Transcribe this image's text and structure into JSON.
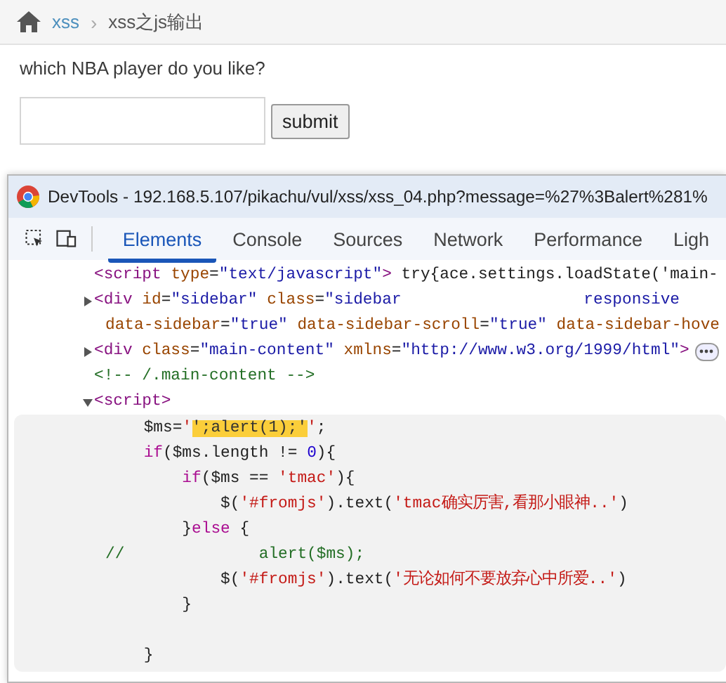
{
  "breadcrumb": {
    "home_link": "xss",
    "separator": "›",
    "current": "xss之js输出"
  },
  "question": "which NBA player do you like?",
  "submit": "submit",
  "devtools": {
    "title": "DevTools - 192.168.5.107/pikachu/vul/xss/xss_04.php?message=%27%3Balert%281%",
    "tabs": [
      {
        "label": "Elements",
        "selected": true
      },
      {
        "label": "Console",
        "selected": false
      },
      {
        "label": "Sources",
        "selected": false
      },
      {
        "label": "Network",
        "selected": false
      },
      {
        "label": "Performance",
        "selected": false
      },
      {
        "label": "Ligh",
        "selected": false
      }
    ],
    "dom": [
      {
        "kind": "partial",
        "lines": [
          [
            {
              "kind": "tag",
              "text": "<script"
            },
            {
              "kind": "attr",
              "text": " type"
            },
            {
              "kind": "plain",
              "text": "="
            },
            {
              "kind": "value",
              "text": "\"text/javascript\""
            },
            {
              "kind": "tag",
              "text": ">"
            },
            {
              "kind": "plain",
              "text": " try{ace.settings.loadState('main-"
            }
          ]
        ]
      },
      {
        "kind": "element",
        "expanded": false,
        "ellipsis": false,
        "lines": [
          [
            {
              "kind": "tag",
              "text": "<div"
            },
            {
              "kind": "attr",
              "text": " id"
            },
            {
              "kind": "plain",
              "text": "="
            },
            {
              "kind": "value",
              "text": "\"sidebar\""
            },
            {
              "kind": "attr",
              "text": " class"
            },
            {
              "kind": "plain",
              "text": "="
            },
            {
              "kind": "value",
              "text": "\"sidebar                   responsive"
            }
          ],
          [
            {
              "kind": "attr",
              "text": "data-sidebar"
            },
            {
              "kind": "plain",
              "text": "="
            },
            {
              "kind": "value",
              "text": "\"true\""
            },
            {
              "kind": "attr",
              "text": " data-sidebar-scroll"
            },
            {
              "kind": "plain",
              "text": "="
            },
            {
              "kind": "value",
              "text": "\"true\""
            },
            {
              "kind": "attr",
              "text": " data-sidebar-hove"
            }
          ]
        ]
      },
      {
        "kind": "element",
        "expanded": false,
        "ellipsis": true,
        "lines": [
          [
            {
              "kind": "tag",
              "text": "<div"
            },
            {
              "kind": "attr",
              "text": " class"
            },
            {
              "kind": "plain",
              "text": "="
            },
            {
              "kind": "value",
              "text": "\"main-content\""
            },
            {
              "kind": "attr",
              "text": " xmlns"
            },
            {
              "kind": "plain",
              "text": "="
            },
            {
              "kind": "value",
              "text": "\"http://www.w3.org/1999/html\""
            },
            {
              "kind": "tag",
              "text": ">"
            }
          ]
        ]
      },
      {
        "kind": "comment",
        "lines": [
          [
            {
              "kind": "comment",
              "text": "<!-- /.main-content -->"
            }
          ]
        ]
      },
      {
        "kind": "element",
        "expanded": true,
        "ellipsis": false,
        "lines": [
          [
            {
              "kind": "tag",
              "text": "<script>"
            }
          ]
        ],
        "code": [
          {
            "kind": "code",
            "tokens": [
              {
                "kind": "plain",
                "text": "    $ms="
              },
              {
                "kind": "string",
                "text": "'"
              },
              {
                "kind": "highlight",
                "text": "';alert(1);'"
              },
              {
                "kind": "string",
                "text": "'"
              },
              {
                "kind": "plain",
                "text": ";"
              }
            ]
          },
          {
            "kind": "code",
            "tokens": [
              {
                "kind": "keyword",
                "text": "    if"
              },
              {
                "kind": "plain",
                "text": "($ms.length != "
              },
              {
                "kind": "number",
                "text": "0"
              },
              {
                "kind": "plain",
                "text": "){"
              }
            ]
          },
          {
            "kind": "code",
            "tokens": [
              {
                "kind": "keyword",
                "text": "        if"
              },
              {
                "kind": "plain",
                "text": "($ms == "
              },
              {
                "kind": "string",
                "text": "'tmac'"
              },
              {
                "kind": "plain",
                "text": "){"
              }
            ]
          },
          {
            "kind": "code",
            "tokens": [
              {
                "kind": "plain",
                "text": "            $("
              },
              {
                "kind": "string",
                "text": "'#fromjs'"
              },
              {
                "kind": "plain",
                "text": ").text("
              },
              {
                "kind": "string",
                "text": "'tmac确实厉害,看那小眼神..'"
              },
              {
                "kind": "plain",
                "text": ")"
              }
            ]
          },
          {
            "kind": "code",
            "tokens": [
              {
                "kind": "plain",
                "text": "        }"
              },
              {
                "kind": "keyword",
                "text": "else"
              },
              {
                "kind": "plain",
                "text": " {"
              }
            ]
          },
          {
            "kind": "code",
            "tokens": [
              {
                "kind": "jscomment",
                "text": "//              alert($ms);"
              }
            ]
          },
          {
            "kind": "code",
            "tokens": [
              {
                "kind": "plain",
                "text": "            $("
              },
              {
                "kind": "string",
                "text": "'#fromjs'"
              },
              {
                "kind": "plain",
                "text": ").text("
              },
              {
                "kind": "string",
                "text": "'无论如何不要放弃心中所爱..'"
              },
              {
                "kind": "plain",
                "text": ")"
              }
            ]
          },
          {
            "kind": "code",
            "tokens": [
              {
                "kind": "plain",
                "text": "        }"
              }
            ]
          },
          {
            "kind": "blank"
          },
          {
            "kind": "code",
            "tokens": [
              {
                "kind": "plain",
                "text": "    }"
              }
            ]
          }
        ]
      }
    ]
  }
}
